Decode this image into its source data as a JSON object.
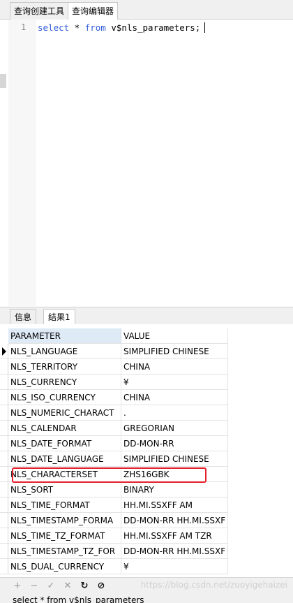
{
  "top_tabs": [
    {
      "label": "查询创建工具",
      "active": false
    },
    {
      "label": "查询编辑器",
      "active": true
    }
  ],
  "editor": {
    "line_number": "1",
    "code": {
      "kw_select": "select",
      "star": " * ",
      "kw_from": "from",
      "rest": " v$nls_parameters;"
    }
  },
  "bottom_tabs": [
    {
      "label": "信息",
      "active": false
    },
    {
      "label": "结果1",
      "active": true
    }
  ],
  "grid": {
    "columns": [
      "PARAMETER",
      "VALUE"
    ],
    "rows": [
      {
        "parameter": "NLS_LANGUAGE",
        "value": "SIMPLIFIED CHINESE"
      },
      {
        "parameter": "NLS_TERRITORY",
        "value": "CHINA"
      },
      {
        "parameter": "NLS_CURRENCY",
        "value": "¥"
      },
      {
        "parameter": "NLS_ISO_CURRENCY",
        "value": "CHINA"
      },
      {
        "parameter": "NLS_NUMERIC_CHARACT",
        "value": "."
      },
      {
        "parameter": "NLS_CALENDAR",
        "value": "GREGORIAN"
      },
      {
        "parameter": "NLS_DATE_FORMAT",
        "value": "DD-MON-RR"
      },
      {
        "parameter": "NLS_DATE_LANGUAGE",
        "value": "SIMPLIFIED CHINESE"
      },
      {
        "parameter": "NLS_CHARACTERSET",
        "value": "ZHS16GBK"
      },
      {
        "parameter": "NLS_SORT",
        "value": "BINARY"
      },
      {
        "parameter": "NLS_TIME_FORMAT",
        "value": "HH.MI.SSXFF AM"
      },
      {
        "parameter": "NLS_TIMESTAMP_FORMA",
        "value": "DD-MON-RR HH.MI.SSXF"
      },
      {
        "parameter": "NLS_TIME_TZ_FORMAT",
        "value": "HH.MI.SSXFF AM TZR"
      },
      {
        "parameter": "NLS_TIMESTAMP_TZ_FOR",
        "value": "DD-MON-RR HH.MI.SSXF"
      },
      {
        "parameter": "NLS_DUAL_CURRENCY",
        "value": "¥"
      }
    ],
    "current_row_index": 0,
    "highlighted_row_index": 8
  },
  "toolbar": {
    "buttons": [
      {
        "icon": "plus-icon",
        "glyph": "+",
        "enabled": false
      },
      {
        "icon": "minus-icon",
        "glyph": "−",
        "enabled": false
      },
      {
        "icon": "check-icon",
        "glyph": "✓",
        "enabled": false
      },
      {
        "icon": "cross-icon",
        "glyph": "✕",
        "enabled": false
      },
      {
        "icon": "refresh-icon",
        "glyph": "↻",
        "enabled": true
      },
      {
        "icon": "stop-icon",
        "glyph": "⊘",
        "enabled": true
      }
    ],
    "watermark": "https://blog.csdn.net/zuoyigehaizei"
  },
  "status": {
    "text": "select * from v$nls_parameters"
  },
  "colors": {
    "keyword": "#2f5bd8",
    "header_highlight": "#dfeaf7",
    "highlight_box": "#e3212a"
  }
}
